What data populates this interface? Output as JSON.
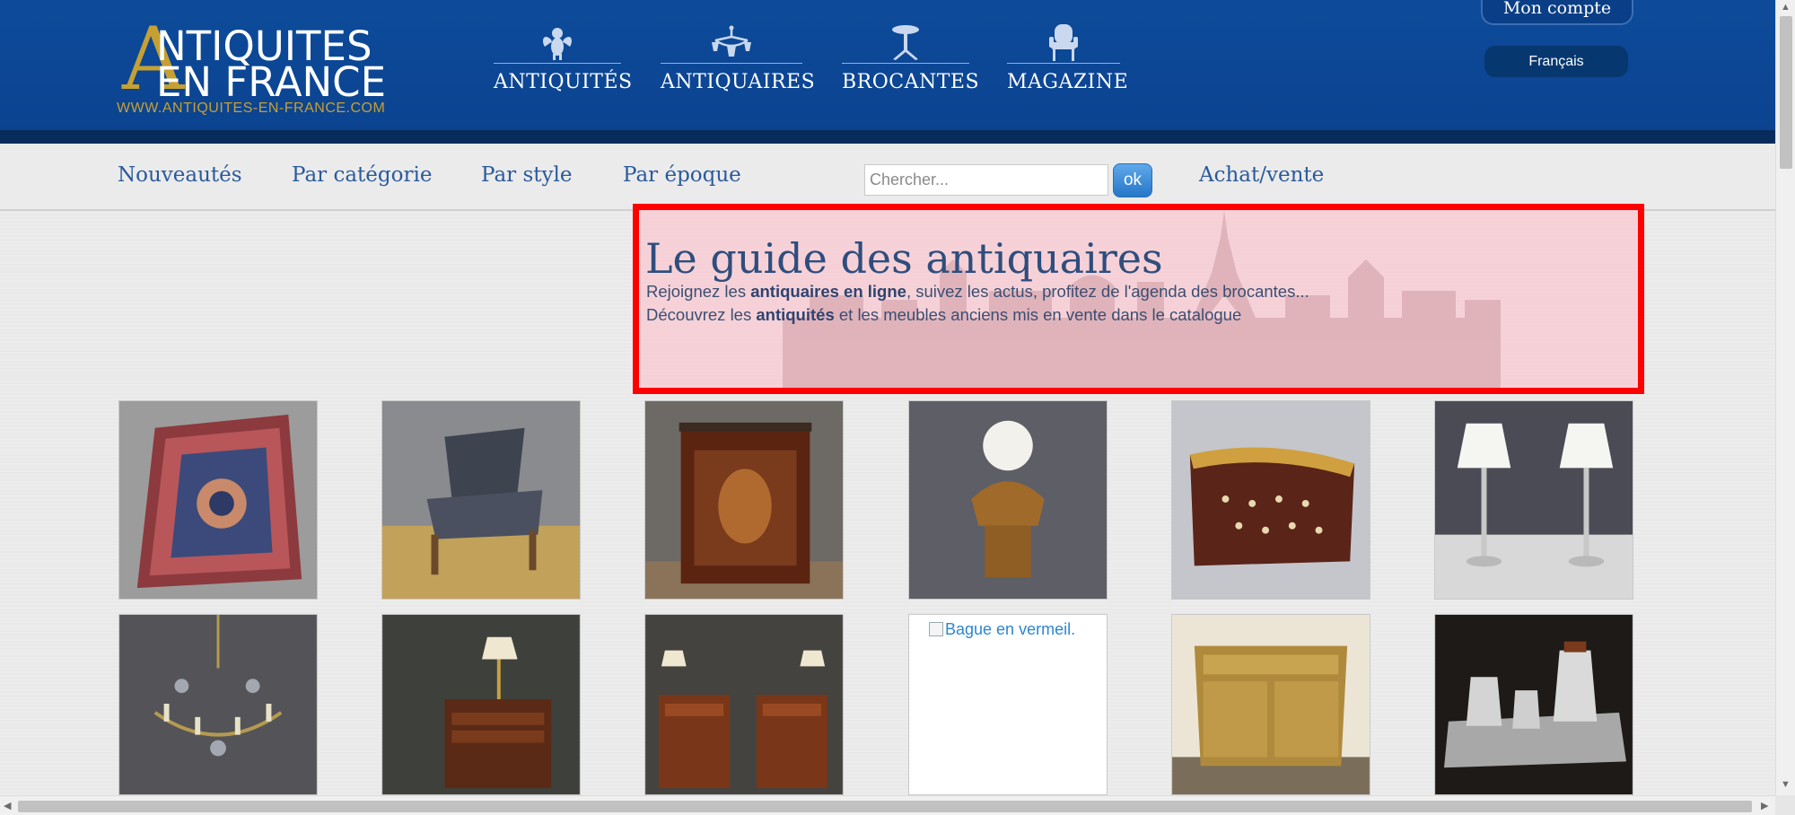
{
  "header": {
    "logo": {
      "initial": "A",
      "line1": "NTIQUITES",
      "line2": "EN FRANCE",
      "url": "WWW.ANTIQUITES-EN-FRANCE.COM"
    },
    "nav": [
      {
        "label": "ANTIQUITÉS",
        "icon": "cherub-icon"
      },
      {
        "label": "ANTIQUAIRES",
        "icon": "chandelier-icon"
      },
      {
        "label": "BROCANTES",
        "icon": "pedestal-table-icon"
      },
      {
        "label": "MAGAZINE",
        "icon": "armchair-icon"
      }
    ],
    "account_label": "Mon compte",
    "language_label": "Français"
  },
  "subnav": {
    "items": [
      "Nouveautés",
      "Par catégorie",
      "Par style",
      "Par époque"
    ],
    "search_placeholder": "Chercher...",
    "search_button": "ok",
    "achat_vente": "Achat/vente"
  },
  "hero": {
    "title": "Le guide des antiquaires",
    "line1_pre": "Rejoignez les ",
    "line1_bold": "antiquaires en ligne",
    "line1_post": ", suivez les actus, profitez de l'agenda des brocantes...",
    "line2_pre": "Découvrez les ",
    "line2_bold": "antiquités",
    "line2_post": " et les meubles anciens mis en vente dans le catalogue"
  },
  "products": [
    {
      "subject": "persian-rug"
    },
    {
      "subject": "upholstered-armchair"
    },
    {
      "subject": "marquetry-cabinet"
    },
    {
      "subject": "child-bust-sculpture"
    },
    {
      "subject": "marquetry-box"
    },
    {
      "subject": "pair-of-silver-lamps"
    },
    {
      "subject": "crystal-chandelier"
    },
    {
      "subject": "nightstand-with-lamp"
    },
    {
      "subject": "pair-of-nightstands"
    },
    {
      "subject": "broken-image",
      "alt": "Bague en vermeil."
    },
    {
      "subject": "painted-commode"
    },
    {
      "subject": "silver-tea-set"
    }
  ]
}
